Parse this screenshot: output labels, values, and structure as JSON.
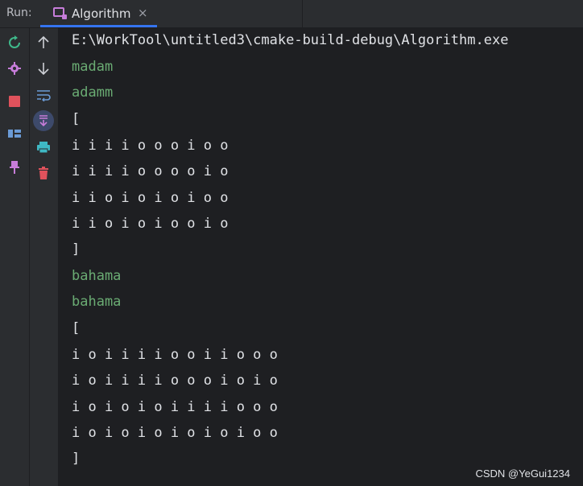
{
  "run_label": "Run:",
  "tab": {
    "title": "Algorithm",
    "close": "×"
  },
  "toolbar1": [
    {
      "icon": "rerun-icon",
      "color": "#3fb98b"
    },
    {
      "icon": "gear-icon",
      "color": "#c77dda"
    },
    {
      "icon": "stop-icon",
      "color": "#e0525c"
    },
    {
      "icon": "layout-icon",
      "color": "#6b9bd6"
    },
    {
      "icon": "pin-icon",
      "color": "#c77dda"
    }
  ],
  "toolbar2": [
    {
      "icon": "arrow-up-icon"
    },
    {
      "icon": "arrow-down-icon"
    },
    {
      "icon": "soft-wrap-icon"
    },
    {
      "icon": "scroll-to-end-icon"
    },
    {
      "icon": "print-icon"
    },
    {
      "icon": "trash-icon"
    }
  ],
  "console": {
    "lines": [
      {
        "text": "E:\\WorkTool\\untitled3\\cmake-build-debug\\Algorithm.exe",
        "kind": "default"
      },
      {
        "text": "madam",
        "kind": "input"
      },
      {
        "text": "adamm",
        "kind": "input"
      },
      {
        "text": "[",
        "kind": "default"
      },
      {
        "text": "i i i i o o o i o o",
        "kind": "default"
      },
      {
        "text": "i i i i o o o o i o",
        "kind": "default"
      },
      {
        "text": "i i o i o i o i o o",
        "kind": "default"
      },
      {
        "text": "i i o i o i o o i o",
        "kind": "default"
      },
      {
        "text": "]",
        "kind": "default"
      },
      {
        "text": "bahama",
        "kind": "input"
      },
      {
        "text": "bahama",
        "kind": "input"
      },
      {
        "text": "[",
        "kind": "default"
      },
      {
        "text": "i o i i i i o o i i o o o",
        "kind": "default"
      },
      {
        "text": "i o i i i i o o o i o i o",
        "kind": "default"
      },
      {
        "text": "i o i o i o i i i i o o o",
        "kind": "default"
      },
      {
        "text": "i o i o i o i o i o i o o",
        "kind": "default"
      },
      {
        "text": "]",
        "kind": "default"
      }
    ]
  },
  "watermark": "CSDN @YeGui1234"
}
